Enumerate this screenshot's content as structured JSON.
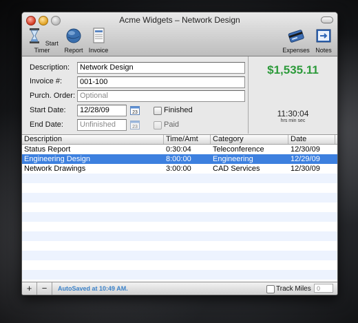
{
  "window": {
    "title": "Acme Widgets – Network Design"
  },
  "toolbar": {
    "start_timer": "Start Timer",
    "report": "Report",
    "invoice": "Invoice",
    "expenses": "Expenses",
    "notes": "Notes"
  },
  "form": {
    "description_label": "Description:",
    "description_value": "Network Design",
    "invoice_label": "Invoice #:",
    "invoice_value": "001-100",
    "po_label": "Purch. Order:",
    "po_placeholder": "Optional",
    "start_label": "Start Date:",
    "start_value": "12/28/09",
    "end_label": "End Date:",
    "end_placeholder": "Unfinished",
    "finished_label": "Finished",
    "paid_label": "Paid",
    "calendar_day": "23"
  },
  "summary": {
    "amount": "$1,535.11",
    "amount_color": "#2c9a3a",
    "timer": "11:30:04",
    "timer_units": "hrs  min  sec"
  },
  "table": {
    "columns": [
      "Description",
      "Time/Amt",
      "Category",
      "Date"
    ],
    "rows": [
      {
        "description": "Status Report",
        "time": "0:30:04",
        "category": "Teleconference",
        "date": "12/30/09"
      },
      {
        "description": "Engineering Design",
        "time": "8:00:00",
        "category": "Engineering",
        "date": "12/29/09",
        "selected": true
      },
      {
        "description": "Network Drawings",
        "time": "3:00:00",
        "category": "CAD Services",
        "date": "12/30/09"
      }
    ],
    "selected_color": "#3d80df"
  },
  "footer": {
    "add": "+",
    "remove": "−",
    "autosave": "AutoSaved at 10:49 AM.",
    "track_miles": "Track Miles",
    "miles_value": "0"
  }
}
